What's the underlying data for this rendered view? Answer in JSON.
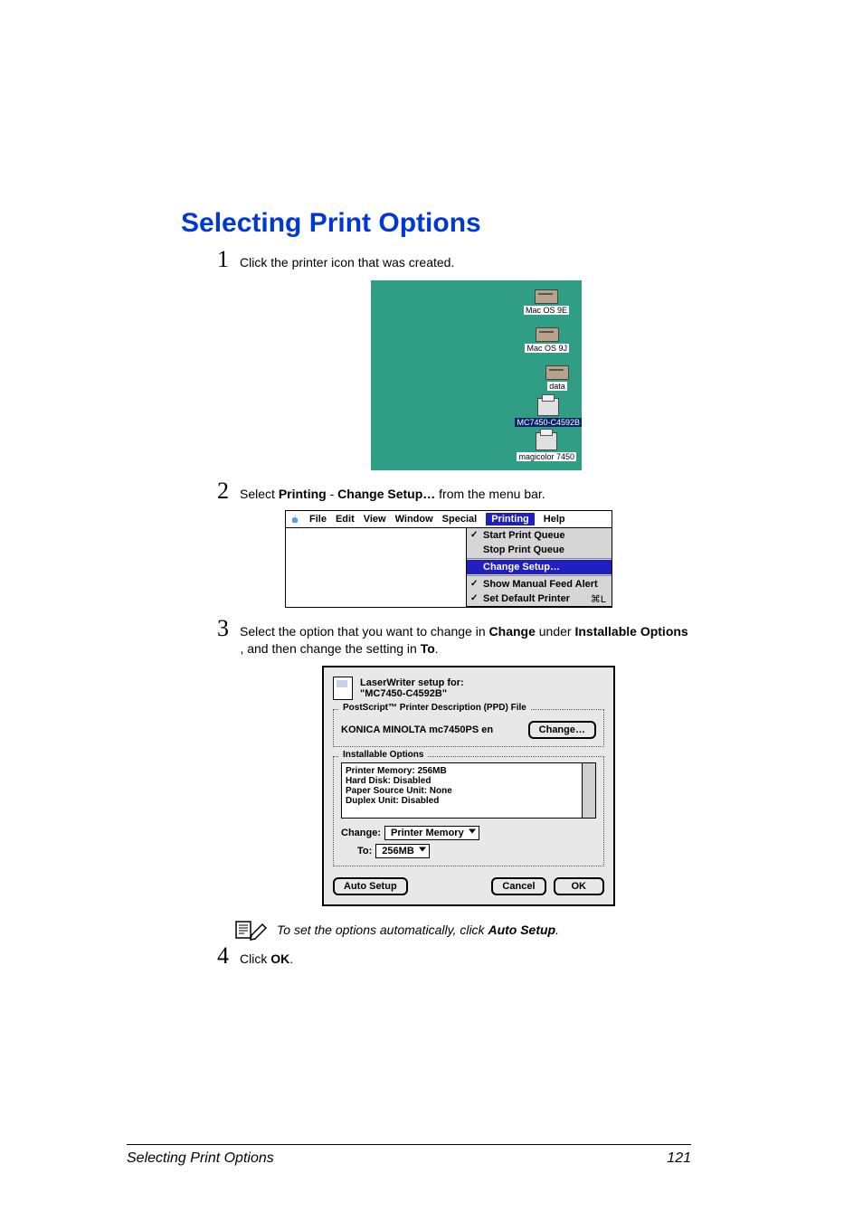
{
  "title": "Selecting Print Options",
  "steps": {
    "s1": {
      "num": "1",
      "text": "Click the printer icon that was created."
    },
    "s2": {
      "num": "2",
      "pre": "Select ",
      "b1": "Printing",
      "mid": " - ",
      "b2": "Change Setup…",
      "post": " from the menu bar."
    },
    "s3": {
      "num": "3",
      "pre": "Select the option that you want to change in ",
      "b1": "Change",
      "mid": " under ",
      "b2": "Installable Options",
      "post2_pre": ", and then change the setting in ",
      "b3": "To",
      "post3": "."
    },
    "s4": {
      "num": "4",
      "pre": "Click ",
      "b1": "OK",
      "post": "."
    }
  },
  "note": {
    "pre": "To set the options automatically, click ",
    "b": "Auto Setup",
    "post": "."
  },
  "desktop": {
    "items": [
      {
        "label": "Mac OS 9E"
      },
      {
        "label": "Mac OS 9J"
      },
      {
        "label": "data"
      },
      {
        "label": "MC7450-C4592B",
        "selected": true
      },
      {
        "label": "magicolor 7450"
      }
    ]
  },
  "menubar": {
    "items": [
      "File",
      "Edit",
      "View",
      "Window",
      "Special",
      "Printing",
      "Help"
    ],
    "highlighted": "Printing",
    "dropdown": [
      {
        "label": "Start Print Queue",
        "checked": true
      },
      {
        "label": "Stop Print Queue"
      },
      {
        "sep": true
      },
      {
        "label": "Change Setup…",
        "selected": true
      },
      {
        "sep": true
      },
      {
        "label": "Show Manual Feed Alert",
        "checked": true
      },
      {
        "label": "Set Default Printer",
        "shortcut": "⌘L",
        "checked": true
      }
    ]
  },
  "dialog": {
    "title1": "LaserWriter setup for:",
    "title2": "\"MC7450-C4592B\"",
    "ppd_group": "PostScript™ Printer Description (PPD) File",
    "ppd_name": "KONICA MINOLTA mc7450PS en",
    "change_btn": "Change…",
    "inst_group": "Installable Options",
    "opts": {
      "mem": {
        "k": "Printer Memory:",
        "v": " 256MB"
      },
      "hd": {
        "k": "Hard Disk:",
        "v": " Disabled"
      },
      "psu": {
        "k": "Paper Source Unit:",
        "v": " None"
      },
      "dup": {
        "k": "Duplex Unit:",
        "v": " Disabled"
      }
    },
    "change_lbl": "Change:",
    "change_val": "Printer Memory",
    "to_lbl": "To:",
    "to_val": "256MB",
    "auto_btn": "Auto Setup",
    "cancel_btn": "Cancel",
    "ok_btn": "OK"
  },
  "footer": {
    "left": "Selecting Print Options",
    "right": "121"
  }
}
